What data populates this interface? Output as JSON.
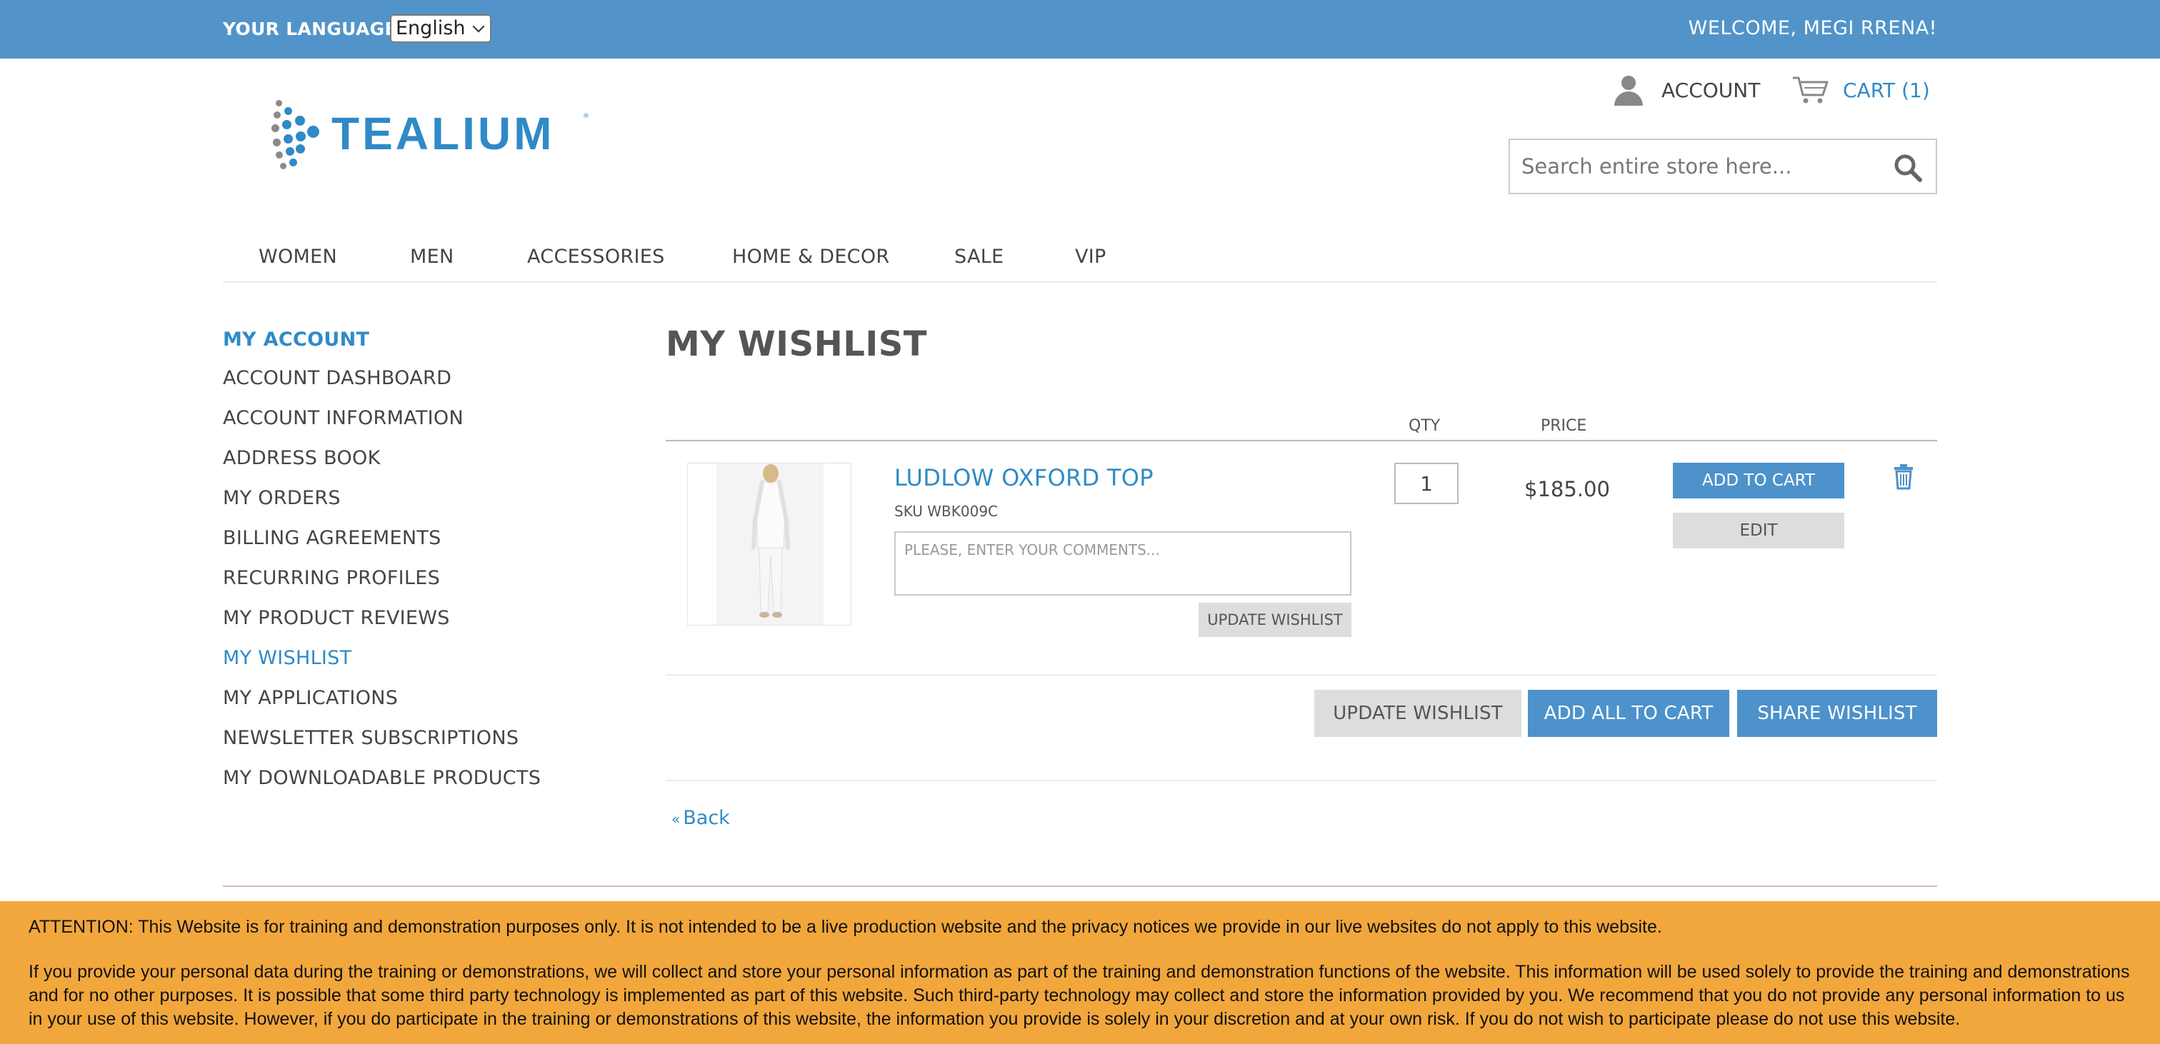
{
  "topbar": {
    "language_label": "YOUR LANGUAGE:",
    "language_value": "English",
    "welcome": "WELCOME, MEGI RRENA!"
  },
  "header": {
    "logo_text": "TEALIUM",
    "logo_tm": "®",
    "account_label": "ACCOUNT",
    "cart_label": "CART (1)",
    "search_placeholder": "Search entire store here..."
  },
  "nav": {
    "items": [
      "WOMEN",
      "MEN",
      "ACCESSORIES",
      "HOME & DECOR",
      "SALE",
      "VIP"
    ]
  },
  "sidebar": {
    "title": "MY ACCOUNT",
    "items": [
      "ACCOUNT DASHBOARD",
      "ACCOUNT INFORMATION",
      "ADDRESS BOOK",
      "MY ORDERS",
      "BILLING AGREEMENTS",
      "RECURRING PROFILES",
      "MY PRODUCT REVIEWS",
      "MY WISHLIST",
      "MY APPLICATIONS",
      "NEWSLETTER SUBSCRIPTIONS",
      "MY DOWNLOADABLE PRODUCTS"
    ],
    "active_item": "MY WISHLIST"
  },
  "main": {
    "title": "MY WISHLIST",
    "columns": {
      "qty": "QTY",
      "price": "PRICE"
    },
    "item": {
      "name": "LUDLOW OXFORD TOP",
      "sku": "SKU WBK009C",
      "comment_placeholder": "PLEASE, ENTER YOUR COMMENTS...",
      "update_label": "UPDATE WISHLIST",
      "qty": "1",
      "price": "$185.00",
      "add_to_cart_label": "ADD TO CART",
      "edit_label": "EDIT"
    },
    "actions": {
      "update_wishlist": "UPDATE WISHLIST",
      "add_all_to_cart": "ADD ALL TO CART",
      "share_wishlist": "SHARE WISHLIST"
    },
    "back_label": "Back",
    "back_icon": "«"
  },
  "notice": {
    "paragraph1": "ATTENTION: This Website is for training and demonstration purposes only. It is not intended to be a live production website and the privacy notices we provide in our live websites do not apply to this website.",
    "paragraph2": "If you provide your personal data during the training or demonstrations, we will collect and store your personal information as part of the training and demonstration functions of the website. This information will be used solely to provide the training and demonstrations and for no other purposes. It is possible that some third party technology is implemented as part of this website. Such third-party technology may collect and store the information provided by you. We recommend that you do not provide any personal information to us in your use of this website. However, if you do participate in the training or demonstrations of this website, the information you provide is solely in your discretion and at your own risk. If you do not wish to participate please do not use this website."
  },
  "colors": {
    "topbar": "#5294c9",
    "accent": "#2f8ac7",
    "button_blue": "#4d92cb",
    "notice": "#f2a73c"
  },
  "icons": [
    "account-icon",
    "cart-icon",
    "search-icon",
    "trash-icon",
    "chevron-down-icon",
    "logo-mark-icon"
  ]
}
